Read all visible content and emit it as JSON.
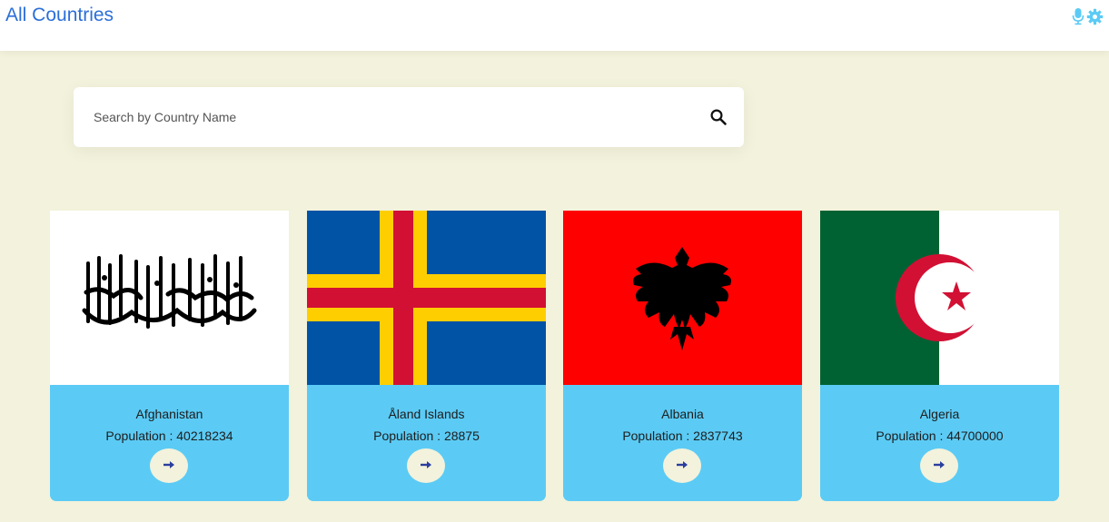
{
  "header": {
    "title": "All Countries",
    "mic_icon": "microphone-icon",
    "settings_icon": "gear-icon"
  },
  "search": {
    "placeholder": "Search by Country Name",
    "value": "",
    "icon": "search-icon"
  },
  "countries": [
    {
      "name": "Afghanistan",
      "population_label": "Population : ",
      "population": "40218234"
    },
    {
      "name": "Åland Islands",
      "population_label": "Population : ",
      "population": "28875"
    },
    {
      "name": "Albania",
      "population_label": "Population : ",
      "population": "2837743"
    },
    {
      "name": "Algeria",
      "population_label": "Population : ",
      "population": "44700000"
    }
  ],
  "colors": {
    "accent_title": "#2b6fd8",
    "background": "#f3f2dc",
    "card_info": "#5bcbf5",
    "arrow": "#2b3f9e"
  }
}
